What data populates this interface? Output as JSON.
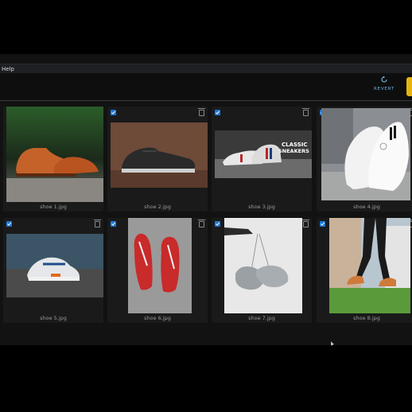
{
  "menu": {
    "help_label": "Help"
  },
  "toolbar": {
    "revert_label": "REVERT"
  },
  "gallery": {
    "items": [
      {
        "caption": "shoe 1.jpg"
      },
      {
        "caption": "shoe 2.jpg"
      },
      {
        "caption": "shoe 3.jpg",
        "overlay": {
          "line1": "CLASSIC",
          "line2": "SNEAKERS"
        }
      },
      {
        "caption": "shoe 4.jpg"
      },
      {
        "caption": "shoe 5.jpg"
      },
      {
        "caption": "shoe 6.jpg"
      },
      {
        "caption": "shoe 7.jpg"
      },
      {
        "caption": "shoe 8.jpg"
      }
    ]
  },
  "colors": {
    "accent": "#1c79d8",
    "revert_text": "#6fb3e0",
    "highlight_button": "#e7b40f"
  }
}
